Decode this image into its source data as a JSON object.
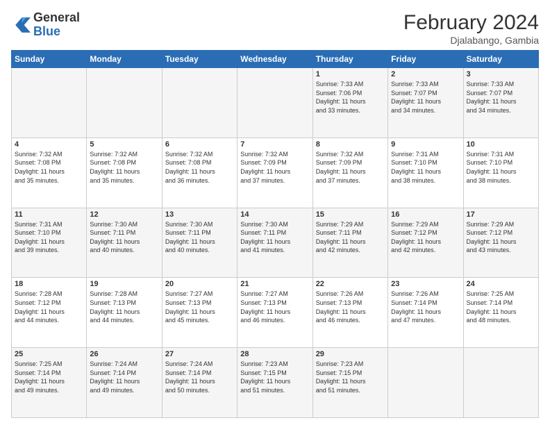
{
  "header": {
    "logo_general": "General",
    "logo_blue": "Blue",
    "month_year": "February 2024",
    "location": "Djalabango, Gambia"
  },
  "days_of_week": [
    "Sunday",
    "Monday",
    "Tuesday",
    "Wednesday",
    "Thursday",
    "Friday",
    "Saturday"
  ],
  "weeks": [
    [
      {
        "day": "",
        "info": ""
      },
      {
        "day": "",
        "info": ""
      },
      {
        "day": "",
        "info": ""
      },
      {
        "day": "",
        "info": ""
      },
      {
        "day": "1",
        "info": "Sunrise: 7:33 AM\nSunset: 7:06 PM\nDaylight: 11 hours\nand 33 minutes."
      },
      {
        "day": "2",
        "info": "Sunrise: 7:33 AM\nSunset: 7:07 PM\nDaylight: 11 hours\nand 34 minutes."
      },
      {
        "day": "3",
        "info": "Sunrise: 7:33 AM\nSunset: 7:07 PM\nDaylight: 11 hours\nand 34 minutes."
      }
    ],
    [
      {
        "day": "4",
        "info": "Sunrise: 7:32 AM\nSunset: 7:08 PM\nDaylight: 11 hours\nand 35 minutes."
      },
      {
        "day": "5",
        "info": "Sunrise: 7:32 AM\nSunset: 7:08 PM\nDaylight: 11 hours\nand 35 minutes."
      },
      {
        "day": "6",
        "info": "Sunrise: 7:32 AM\nSunset: 7:08 PM\nDaylight: 11 hours\nand 36 minutes."
      },
      {
        "day": "7",
        "info": "Sunrise: 7:32 AM\nSunset: 7:09 PM\nDaylight: 11 hours\nand 37 minutes."
      },
      {
        "day": "8",
        "info": "Sunrise: 7:32 AM\nSunset: 7:09 PM\nDaylight: 11 hours\nand 37 minutes."
      },
      {
        "day": "9",
        "info": "Sunrise: 7:31 AM\nSunset: 7:10 PM\nDaylight: 11 hours\nand 38 minutes."
      },
      {
        "day": "10",
        "info": "Sunrise: 7:31 AM\nSunset: 7:10 PM\nDaylight: 11 hours\nand 38 minutes."
      }
    ],
    [
      {
        "day": "11",
        "info": "Sunrise: 7:31 AM\nSunset: 7:10 PM\nDaylight: 11 hours\nand 39 minutes."
      },
      {
        "day": "12",
        "info": "Sunrise: 7:30 AM\nSunset: 7:11 PM\nDaylight: 11 hours\nand 40 minutes."
      },
      {
        "day": "13",
        "info": "Sunrise: 7:30 AM\nSunset: 7:11 PM\nDaylight: 11 hours\nand 40 minutes."
      },
      {
        "day": "14",
        "info": "Sunrise: 7:30 AM\nSunset: 7:11 PM\nDaylight: 11 hours\nand 41 minutes."
      },
      {
        "day": "15",
        "info": "Sunrise: 7:29 AM\nSunset: 7:11 PM\nDaylight: 11 hours\nand 42 minutes."
      },
      {
        "day": "16",
        "info": "Sunrise: 7:29 AM\nSunset: 7:12 PM\nDaylight: 11 hours\nand 42 minutes."
      },
      {
        "day": "17",
        "info": "Sunrise: 7:29 AM\nSunset: 7:12 PM\nDaylight: 11 hours\nand 43 minutes."
      }
    ],
    [
      {
        "day": "18",
        "info": "Sunrise: 7:28 AM\nSunset: 7:12 PM\nDaylight: 11 hours\nand 44 minutes."
      },
      {
        "day": "19",
        "info": "Sunrise: 7:28 AM\nSunset: 7:13 PM\nDaylight: 11 hours\nand 44 minutes."
      },
      {
        "day": "20",
        "info": "Sunrise: 7:27 AM\nSunset: 7:13 PM\nDaylight: 11 hours\nand 45 minutes."
      },
      {
        "day": "21",
        "info": "Sunrise: 7:27 AM\nSunset: 7:13 PM\nDaylight: 11 hours\nand 46 minutes."
      },
      {
        "day": "22",
        "info": "Sunrise: 7:26 AM\nSunset: 7:13 PM\nDaylight: 11 hours\nand 46 minutes."
      },
      {
        "day": "23",
        "info": "Sunrise: 7:26 AM\nSunset: 7:14 PM\nDaylight: 11 hours\nand 47 minutes."
      },
      {
        "day": "24",
        "info": "Sunrise: 7:25 AM\nSunset: 7:14 PM\nDaylight: 11 hours\nand 48 minutes."
      }
    ],
    [
      {
        "day": "25",
        "info": "Sunrise: 7:25 AM\nSunset: 7:14 PM\nDaylight: 11 hours\nand 49 minutes."
      },
      {
        "day": "26",
        "info": "Sunrise: 7:24 AM\nSunset: 7:14 PM\nDaylight: 11 hours\nand 49 minutes."
      },
      {
        "day": "27",
        "info": "Sunrise: 7:24 AM\nSunset: 7:14 PM\nDaylight: 11 hours\nand 50 minutes."
      },
      {
        "day": "28",
        "info": "Sunrise: 7:23 AM\nSunset: 7:15 PM\nDaylight: 11 hours\nand 51 minutes."
      },
      {
        "day": "29",
        "info": "Sunrise: 7:23 AM\nSunset: 7:15 PM\nDaylight: 11 hours\nand 51 minutes."
      },
      {
        "day": "",
        "info": ""
      },
      {
        "day": "",
        "info": ""
      }
    ]
  ]
}
